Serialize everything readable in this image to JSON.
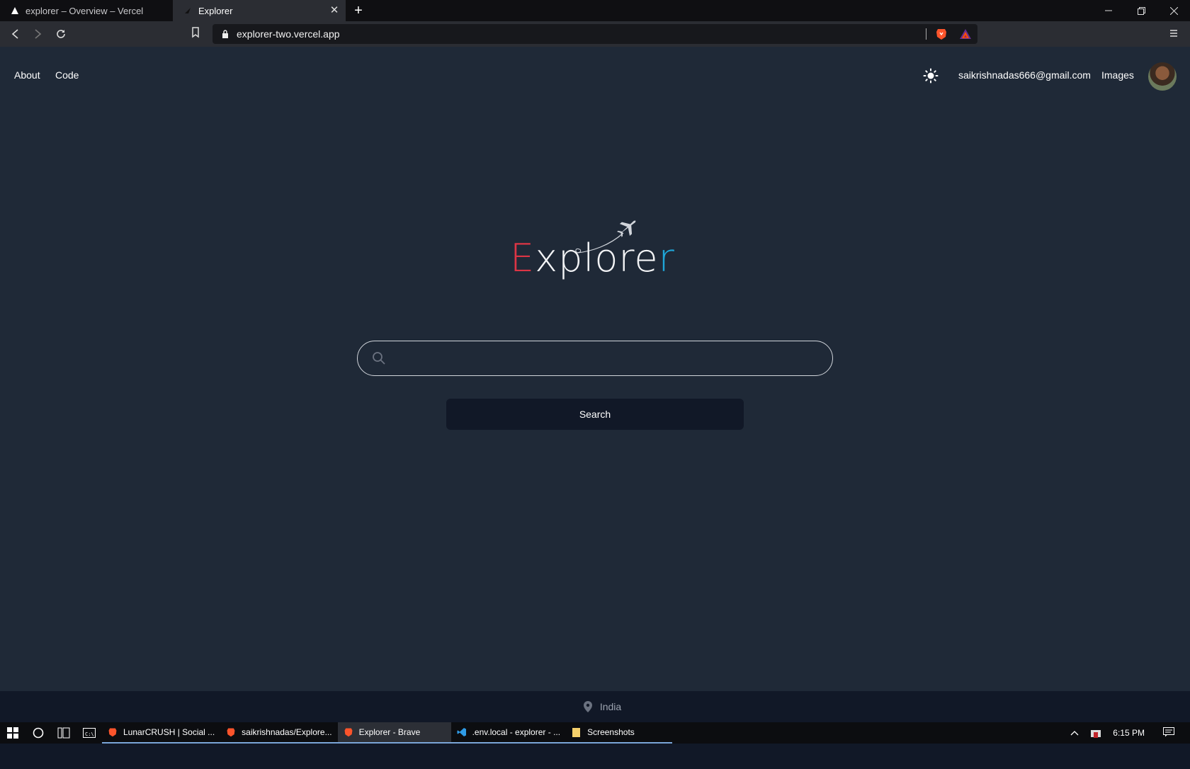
{
  "browser": {
    "tabs": [
      {
        "title": "explorer – Overview – Vercel",
        "active": false
      },
      {
        "title": "Explorer",
        "active": true
      }
    ],
    "url": "explorer-two.vercel.app"
  },
  "page": {
    "nav": {
      "about": "About",
      "code": "Code",
      "email": "saikrishnadas666@gmail.com",
      "images": "Images"
    },
    "logo": {
      "first": "E",
      "middle": "xplore",
      "last": "r"
    },
    "search": {
      "placeholder": "",
      "button": "Search"
    },
    "footer": {
      "location": "India"
    }
  },
  "taskbar": {
    "apps": [
      {
        "label": "LunarCRUSH | Social ...",
        "icon": "brave-icon",
        "active": false
      },
      {
        "label": "saikrishnadas/Explore...",
        "icon": "brave-icon",
        "active": false
      },
      {
        "label": "Explorer - Brave",
        "icon": "brave-icon",
        "active": true
      },
      {
        "label": ".env.local - explorer - ...",
        "icon": "vscode-icon",
        "active": false
      },
      {
        "label": "Screenshots",
        "icon": "folder-icon",
        "active": false
      }
    ],
    "time": "6:15 PM"
  },
  "colors": {
    "accent_red": "#dc3545",
    "accent_blue": "#1fa6d8",
    "page_bg": "#1f2937",
    "footer_bg": "#111827"
  }
}
